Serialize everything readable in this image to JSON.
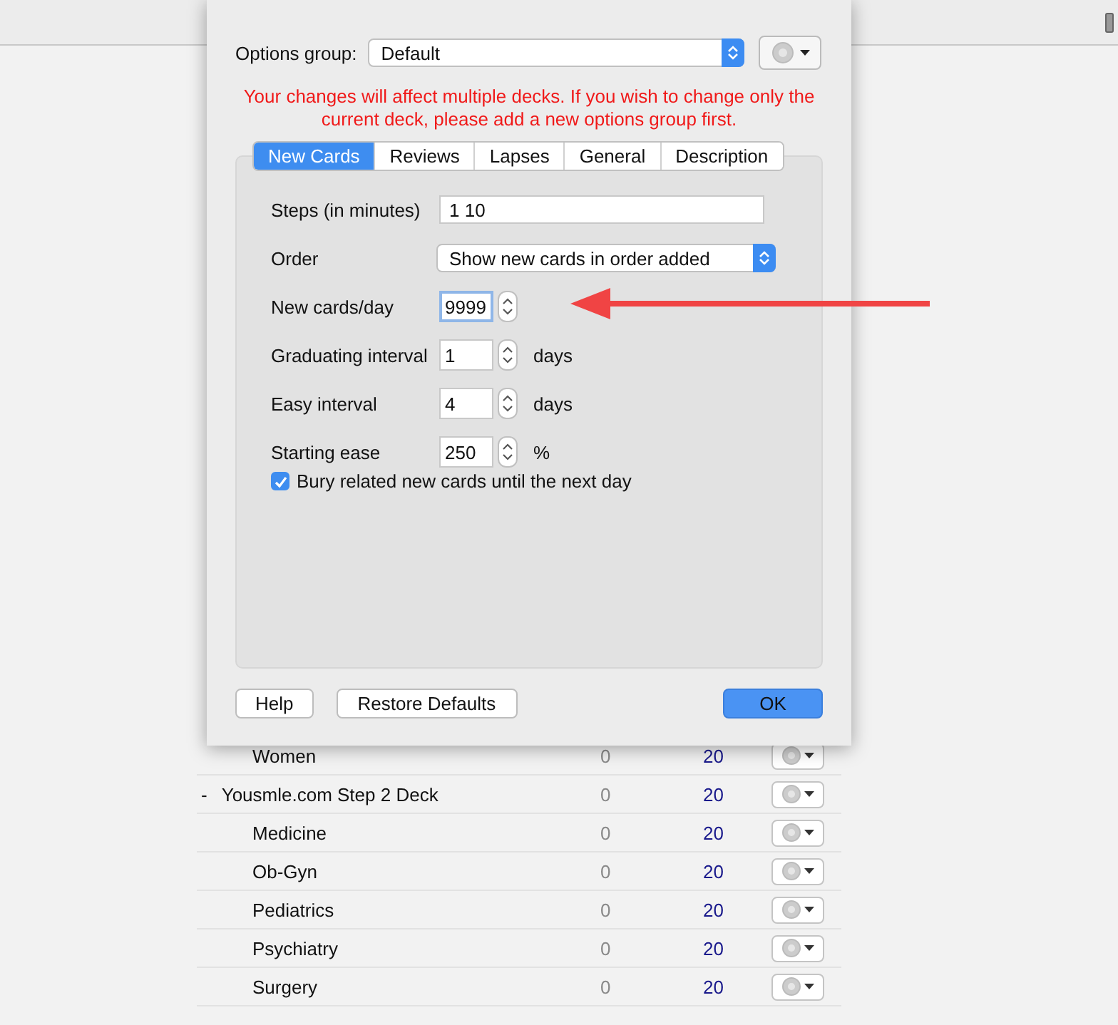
{
  "deck_list": [
    {
      "children": [
        {
          "name": "Women",
          "due": "0",
          "new": "20"
        }
      ]
    },
    {
      "name": "Yousmle.com Step 2 Deck",
      "expander": "-",
      "due": "0",
      "new": "20",
      "children": [
        {
          "name": "Medicine",
          "due": "0",
          "new": "20"
        },
        {
          "name": "Ob-Gyn",
          "due": "0",
          "new": "20"
        },
        {
          "name": "Pediatrics",
          "due": "0",
          "new": "20"
        },
        {
          "name": "Psychiatry",
          "due": "0",
          "new": "20"
        },
        {
          "name": "Surgery",
          "due": "0",
          "new": "20"
        }
      ]
    }
  ],
  "dialog": {
    "options_group": {
      "label": "Options group:",
      "value": "Default"
    },
    "warning": "Your changes will affect multiple decks. If you wish to change only the current deck, please add a new options group first.",
    "tabs": [
      {
        "label": "New Cards",
        "selected": true
      },
      {
        "label": "Reviews",
        "selected": false
      },
      {
        "label": "Lapses",
        "selected": false
      },
      {
        "label": "General",
        "selected": false
      },
      {
        "label": "Description",
        "selected": false
      }
    ],
    "fields": [
      {
        "kind": "text",
        "label": "Steps (in minutes)",
        "value": "1 10"
      },
      {
        "kind": "select",
        "label": "Order",
        "value": "Show new cards in order added"
      },
      {
        "kind": "spin",
        "label": "New cards/day",
        "value": "9999",
        "focused": true
      },
      {
        "kind": "spin",
        "label": "Graduating interval",
        "value": "1",
        "unit": "days",
        "focused": false
      },
      {
        "kind": "spin",
        "label": "Easy interval",
        "value": "4",
        "unit": "days",
        "focused": false
      },
      {
        "kind": "spin",
        "label": "Starting ease",
        "value": "250",
        "unit": "%",
        "focused": false
      }
    ],
    "checkbox": {
      "label": "Bury related new cards until the next day",
      "checked": true
    },
    "buttons": {
      "help": "Help",
      "restore": "Restore Defaults",
      "ok": "OK"
    }
  }
}
